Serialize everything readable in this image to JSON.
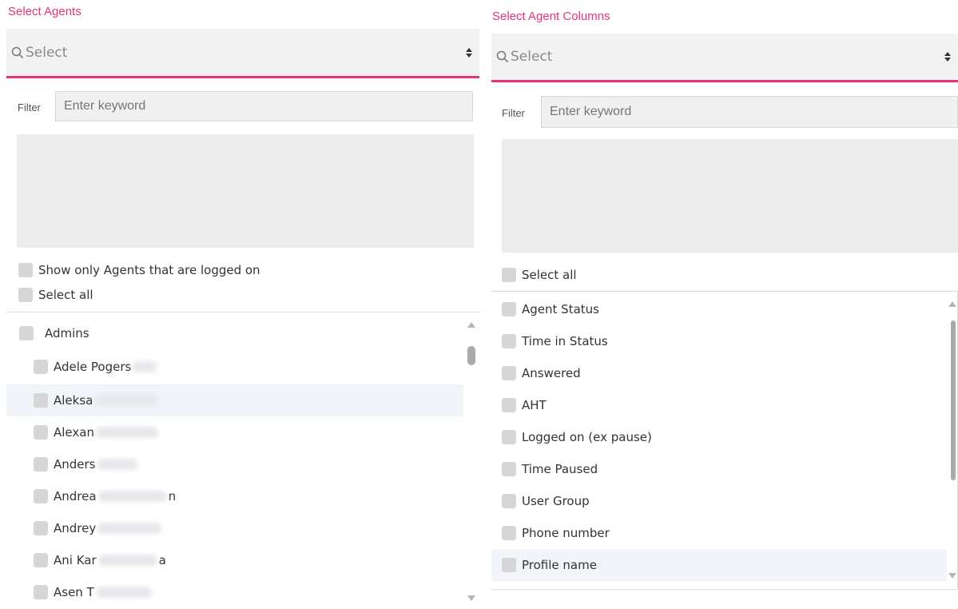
{
  "agents_panel": {
    "title": "Select Agents",
    "select_placeholder": "Select",
    "filter_label": "Filter",
    "filter_placeholder": "Enter keyword",
    "show_logged_on_label": "Show only Agents that are logged on",
    "select_all_label": "Select all",
    "group": {
      "label": "Admins"
    },
    "items": [
      {
        "label": "Adele Pogers",
        "blurred": true
      },
      {
        "label": "Aleksa",
        "blurred": true
      },
      {
        "label": "Alexan",
        "blurred": true
      },
      {
        "label": "Anders",
        "blurred": true
      },
      {
        "label": "Andrea",
        "suffix": "n",
        "blurred": true
      },
      {
        "label": "Andrey",
        "blurred": true
      },
      {
        "label": "Ani Kar",
        "suffix": "a",
        "blurred": true
      },
      {
        "label": "Asen T",
        "blurred": true
      }
    ]
  },
  "columns_panel": {
    "title": "Select Agent Columns",
    "select_placeholder": "Select",
    "filter_label": "Filter",
    "filter_placeholder": "Enter keyword",
    "select_all_label": "Select all",
    "items": [
      {
        "label": "Agent Status"
      },
      {
        "label": "Time in Status"
      },
      {
        "label": "Answered"
      },
      {
        "label": "AHT"
      },
      {
        "label": "Logged on (ex pause)"
      },
      {
        "label": "Time Paused"
      },
      {
        "label": "User Group"
      },
      {
        "label": "Phone number"
      },
      {
        "label": "Profile name"
      }
    ]
  },
  "colors": {
    "accent": "#e8327a",
    "highlight_row": "#f1f5fa",
    "checkbox": "#d6d6d6"
  }
}
